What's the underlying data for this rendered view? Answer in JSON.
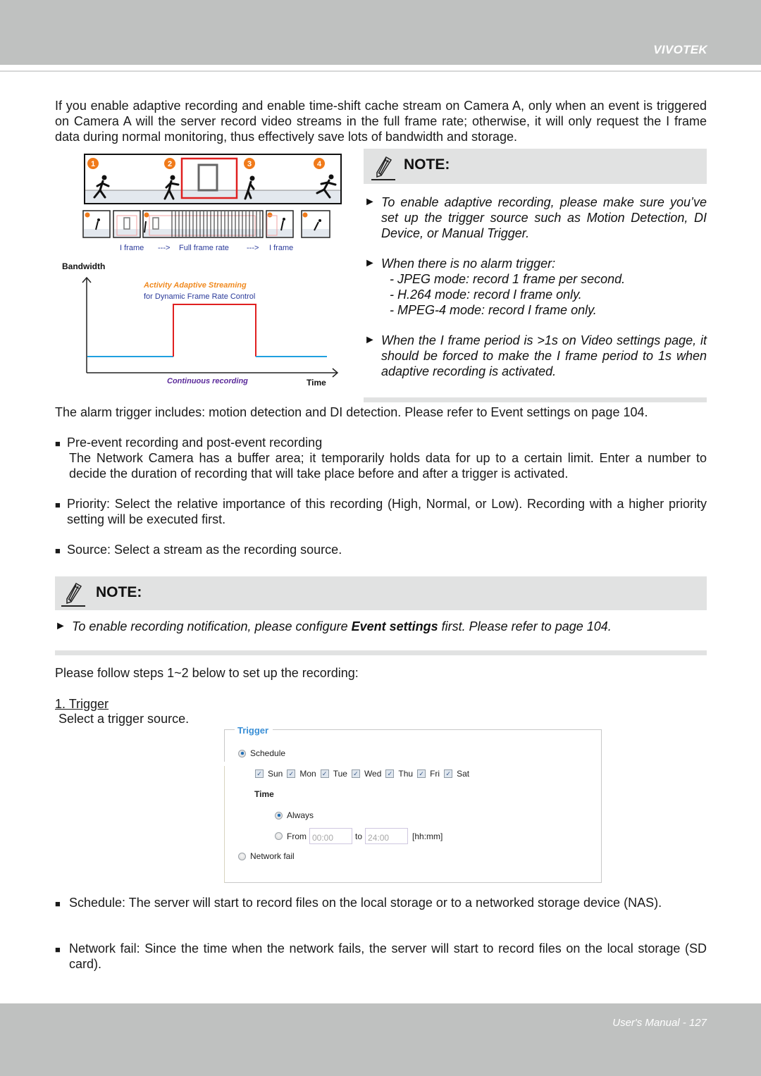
{
  "header": {
    "brand": "VIVOTEK"
  },
  "footer": {
    "page_label": "User's Manual - 127"
  },
  "intro": "If you enable adaptive recording and enable time-shift cache stream on Camera A, only when an event is triggered on Camera A will the server record video streams in the full frame rate; otherwise, it will only request the I frame data during normal monitoring, thus effectively save lots of bandwidth and storage.",
  "figure": {
    "markers": [
      "1",
      "2",
      "3",
      "4"
    ],
    "frame_caption": {
      "left": "I frame",
      "arrow1": "--->",
      "middle": "Full frame rate",
      "arrow2": "--->",
      "right": "I frame"
    },
    "y_label": "Bandwidth",
    "x_label": "Time",
    "annotation_title": "Activity Adaptive Streaming",
    "annotation_sub": "for Dynamic Frame Rate Control",
    "baseline_label": "Continuous recording",
    "colors": {
      "marker": "#f07a1a",
      "highlight": "#e02020",
      "baseline": "#1fa0e0",
      "caption": "#2a3a9a",
      "annotation": "#f08a20",
      "baseline_label": "#5a2a9a"
    }
  },
  "note1": {
    "title": "NOTE:",
    "items": [
      "To enable adaptive recording, please make sure you’ve set up the trigger source such as Motion Detection, DI Device, or Manual Trigger.",
      "When there is no alarm trigger:",
      "When the I frame period is >1s on Video settings page, it should be forced to make the I frame period to 1s when adaptive recording is activated."
    ],
    "subitems": [
      "- JPEG mode: record 1 frame per second.",
      "- H.264 mode: record I frame only.",
      "- MPEG-4 mode: record I frame only."
    ]
  },
  "alarm_text": "The alarm trigger includes: motion detection and DI detection. Please refer to Event settings on page 104.",
  "bullets": {
    "pre_event_title": "Pre-event recording and post-event recording",
    "pre_event_body": "The Network Camera has a buffer area; it temporarily holds data for up to a certain limit. Enter a number to decide the duration of recording that will take place before and after a trigger is activated.",
    "priority": "Priority: Select the relative importance of this recording (High, Normal, or Low). Recording with a higher priority setting will be executed first.",
    "source": "Source: Select a stream as the recording source."
  },
  "note2": {
    "title": "NOTE:",
    "text_before": "To enable recording notification, please configure ",
    "text_bold": "Event settings",
    "text_after": " first. Please refer to page 104."
  },
  "steps_intro": "Please follow steps 1~2 below to set up the recording:",
  "step1": {
    "title": "1. Trigger",
    "desc": "Select a trigger source."
  },
  "trigger_panel": {
    "legend": "Trigger",
    "schedule_label": "Schedule",
    "schedule_selected": true,
    "days": [
      {
        "label": "Sun",
        "checked": true
      },
      {
        "label": "Mon",
        "checked": true
      },
      {
        "label": "Tue",
        "checked": true
      },
      {
        "label": "Wed",
        "checked": true
      },
      {
        "label": "Thu",
        "checked": true
      },
      {
        "label": "Fri",
        "checked": true
      },
      {
        "label": "Sat",
        "checked": true
      }
    ],
    "time_label": "Time",
    "always_label": "Always",
    "always_selected": true,
    "from_label": "From",
    "from_value": "00:00",
    "to_label": "to",
    "to_value": "24:00",
    "format_hint": "[hh:mm]",
    "network_fail_label": "Network fail",
    "network_fail_selected": false
  },
  "explanations": {
    "schedule": "Schedule: The server will start to record files on the local storage or to a networked storage device (NAS).",
    "network_fail": "Network fail: Since the time when the network fails, the server will start to record files on the local storage (SD card)."
  },
  "glyphs": {
    "bullet": "■",
    "triangle": "►",
    "check": "✓"
  }
}
